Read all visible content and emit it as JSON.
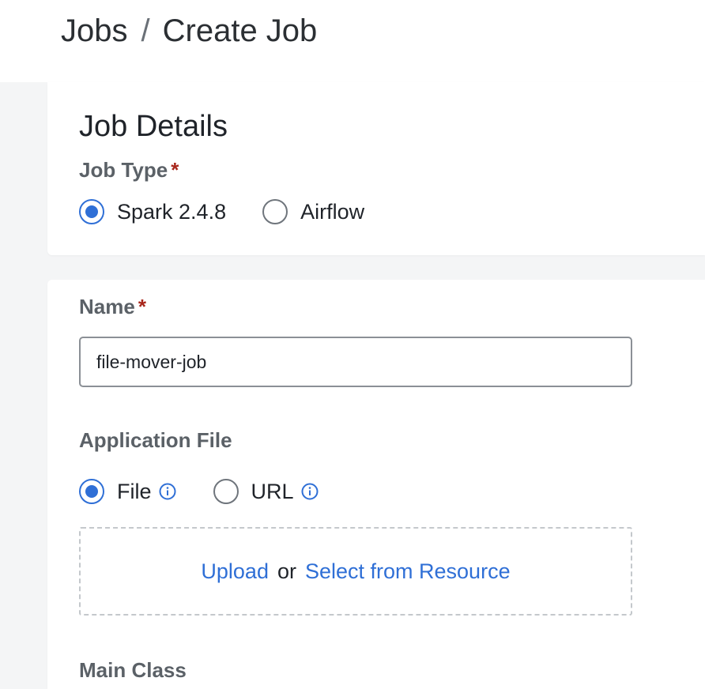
{
  "breadcrumb": {
    "root": "Jobs",
    "separator": "/",
    "current": "Create Job"
  },
  "job_details": {
    "title": "Job Details",
    "job_type": {
      "label": "Job Type",
      "required_marker": "*",
      "options": [
        {
          "label": "Spark 2.4.8",
          "checked": true
        },
        {
          "label": "Airflow",
          "checked": false
        }
      ]
    }
  },
  "form": {
    "name": {
      "label": "Name",
      "required_marker": "*",
      "value": "file-mover-job"
    },
    "application_file": {
      "label": "Application File",
      "options": [
        {
          "label": "File",
          "checked": true,
          "icon": "info-icon"
        },
        {
          "label": "URL",
          "checked": false,
          "icon": "info-icon"
        }
      ],
      "dropzone": {
        "upload_link": "Upload",
        "or_text": "or",
        "resource_link": "Select from Resource"
      }
    },
    "main_class": {
      "label": "Main Class"
    }
  },
  "colors": {
    "accent": "#2f6fd6",
    "required": "#a8261b",
    "page_background": "#f4f5f6"
  }
}
